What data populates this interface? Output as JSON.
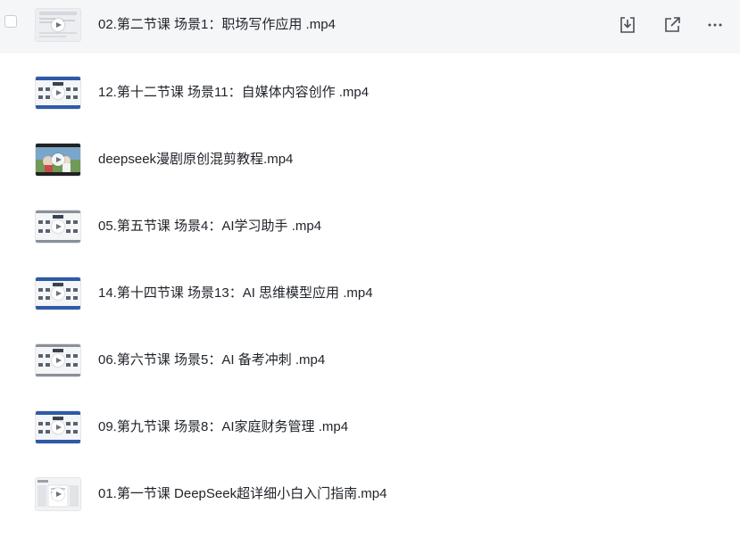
{
  "files": [
    {
      "name": "02.第二节课 场景1：职场写作应用 .mp4",
      "thumb": "doc-light",
      "hovered": true
    },
    {
      "name": "12.第十二节课 场景11：自媒体内容创作 .mp4",
      "thumb": "grid-blue"
    },
    {
      "name": "deepseek漫剧原创混剪教程.mp4",
      "thumb": "photo"
    },
    {
      "name": "05.第五节课 场景4：AI学习助手 .mp4",
      "thumb": "grid-gray"
    },
    {
      "name": "14.第十四节课 场景13：AI 思维模型应用 .mp4",
      "thumb": "grid-blue"
    },
    {
      "name": "06.第六节课 场景5：AI 备考冲刺 .mp4",
      "thumb": "grid-gray"
    },
    {
      "name": "09.第九节课 场景8：AI家庭财务管理 .mp4",
      "thumb": "grid-blue"
    },
    {
      "name": "01.第一节课 DeepSeek超详细小白入门指南.mp4",
      "thumb": "doc-panel"
    }
  ],
  "row_actions": {
    "download_icon": "download-icon",
    "share_icon": "share-icon",
    "more_icon": "more-icon"
  },
  "colors": {
    "hover_bg": "#f5f6f8",
    "text": "#1f2329",
    "icon": "#4a4f57",
    "thumb_accent": "#2e5aa8"
  }
}
